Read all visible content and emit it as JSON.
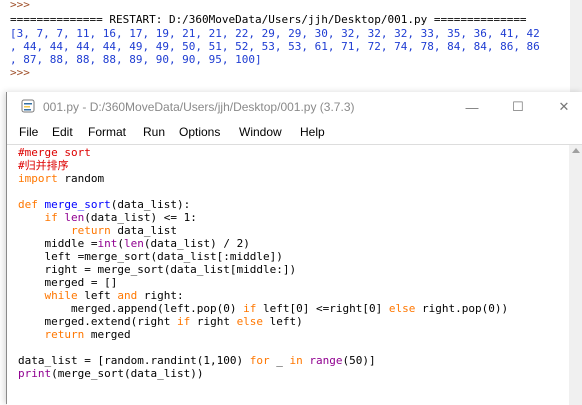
{
  "shell": {
    "prompt_top": ">>>",
    "restart_line": "============== RESTART: D:/360MoveData/Users/jjh/Desktop/001.py ==============",
    "output_lines": [
      "[3, 7, 7, 11, 16, 17, 19, 21, 21, 22, 29, 29, 30, 32, 32, 32, 33, 35, 36, 41, 42",
      ", 44, 44, 44, 44, 49, 49, 50, 51, 52, 53, 53, 61, 71, 72, 74, 78, 84, 84, 86, 86",
      ", 87, 88, 88, 88, 89, 90, 90, 95, 100]"
    ],
    "prompt_bottom": ">>>"
  },
  "window": {
    "title": "001.py - D:/360MoveData/Users/jjh/Desktop/001.py (3.7.3)",
    "minimize": "—",
    "maximize": "☐",
    "close": "✕",
    "icon": "python-file-icon"
  },
  "menu": {
    "file": "File",
    "edit": "Edit",
    "format": "Format",
    "run": "Run",
    "options": "Options",
    "window": "Window",
    "help": "Help"
  },
  "code": {
    "l1": "#merge sort",
    "l2": "#归并排序",
    "l3_kw": "import",
    "l3_rest": " random",
    "l5_kw": "def",
    "l5_name": "merge_sort",
    "l5_rest": "(data_list):",
    "l6_indent": "    ",
    "l6_kw": "if",
    "l6_bi": "len",
    "l6_rest": "(data_list) <= 1:",
    "l7_indent": "        ",
    "l7_kw": "return",
    "l7_rest": " data_list",
    "l8_a": "    middle =",
    "l8_bi1": "int",
    "l8_b": "(",
    "l8_bi2": "len",
    "l8_c": "(data_list) / 2)",
    "l9": "    left =merge_sort(data_list[:middle])",
    "l10": "    right = merge_sort(data_list[middle:])",
    "l11": "    merged = []",
    "l12_indent": "    ",
    "l12_kw1": "while",
    "l12_a": " left ",
    "l12_kw2": "and",
    "l12_b": " right:",
    "l13_a": "        merged.append(left.pop(0) ",
    "l13_kw1": "if",
    "l13_b": " left[0] <=right[0] ",
    "l13_kw2": "else",
    "l13_c": " right.pop(0))",
    "l14_a": "    merged.extend(right ",
    "l14_kw1": "if",
    "l14_b": " right ",
    "l14_kw2": "else",
    "l14_c": " left)",
    "l15_indent": "    ",
    "l15_kw": "return",
    "l15_rest": " merged",
    "l17_a": "data_list = [random.randint(1,100) ",
    "l17_kw1": "for",
    "l17_b": " _ ",
    "l17_kw2": "in",
    "l17_sp": " ",
    "l17_bi": "range",
    "l17_c": "(50)]",
    "l18_bi": "print",
    "l18_rest": "(merge_sort(data_list))"
  },
  "colors": {
    "keyword": "#ff7700",
    "builtin": "#900090",
    "comment": "#dd0000",
    "definition": "#0000ff",
    "shell_output": "#1e3cd2",
    "prompt": "#a0522d"
  }
}
